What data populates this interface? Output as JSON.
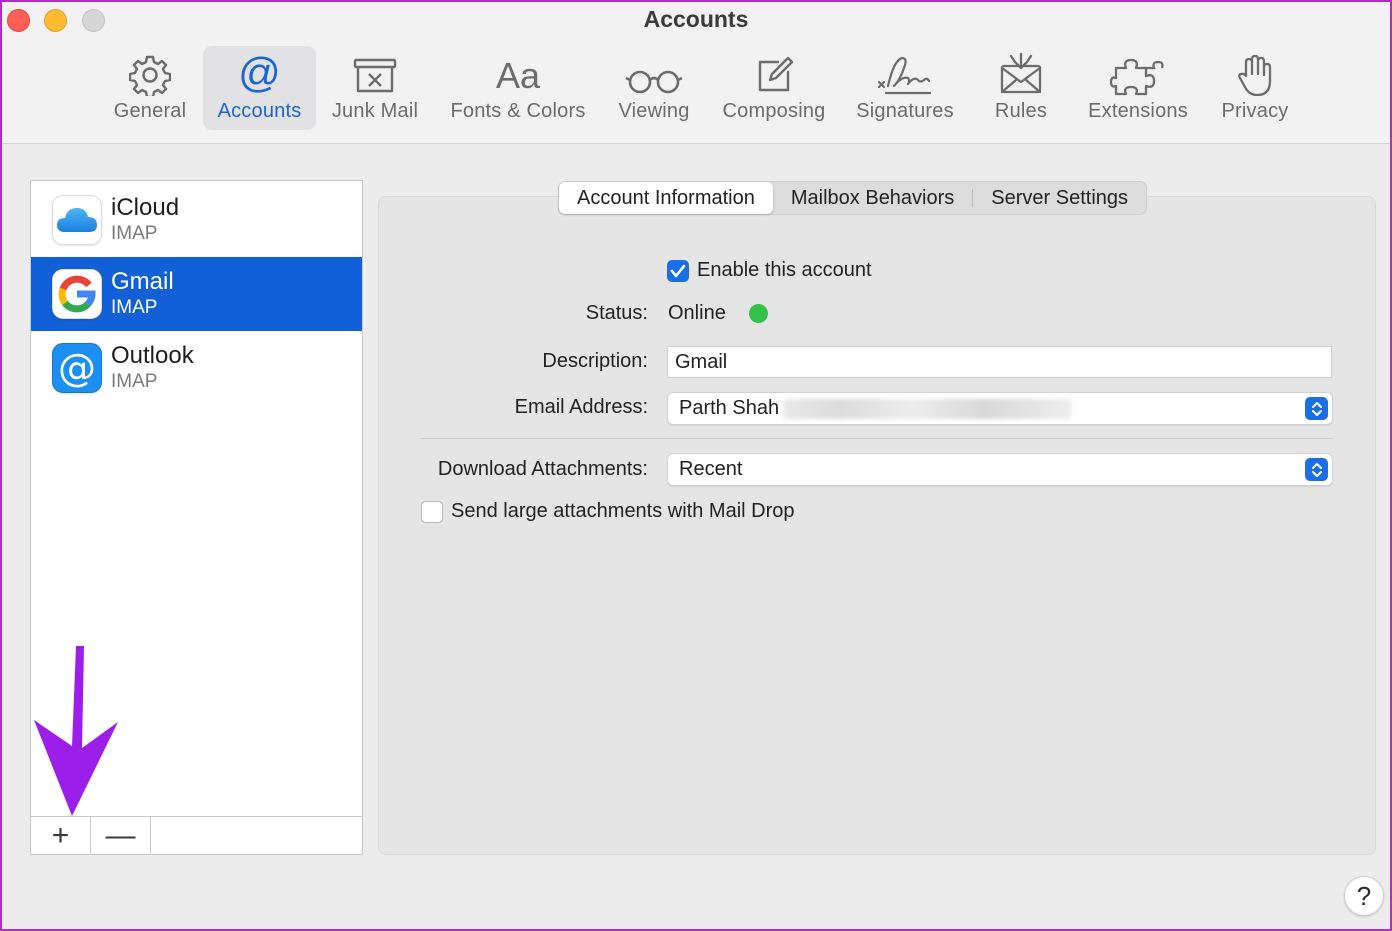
{
  "window": {
    "title": "Accounts"
  },
  "toolbar": {
    "items": [
      {
        "label": "General",
        "icon": "gear-icon"
      },
      {
        "label": "Accounts",
        "icon": "at-icon",
        "glyph": "@"
      },
      {
        "label": "Junk Mail",
        "icon": "junk-icon"
      },
      {
        "label": "Fonts & Colors",
        "icon": "fonts-icon",
        "glyph": "Aa"
      },
      {
        "label": "Viewing",
        "icon": "glasses-icon"
      },
      {
        "label": "Composing",
        "icon": "compose-icon"
      },
      {
        "label": "Signatures",
        "icon": "signature-icon"
      },
      {
        "label": "Rules",
        "icon": "rules-icon"
      },
      {
        "label": "Extensions",
        "icon": "puzzle-icon"
      },
      {
        "label": "Privacy",
        "icon": "hand-icon"
      }
    ],
    "active": "Accounts"
  },
  "sidebar": {
    "accounts": [
      {
        "name": "iCloud",
        "type": "IMAP",
        "icon": "icloud-icon"
      },
      {
        "name": "Gmail",
        "type": "IMAP",
        "icon": "gmail-icon",
        "selected": true
      },
      {
        "name": "Outlook",
        "type": "IMAP",
        "icon": "outlook-icon",
        "glyph": "@"
      }
    ],
    "add_label": "+",
    "remove_label": "—"
  },
  "tabs": [
    {
      "label": "Account Information",
      "active": true
    },
    {
      "label": "Mailbox Behaviors"
    },
    {
      "label": "Server Settings"
    }
  ],
  "form": {
    "enable_label": "Enable this account",
    "enable_checked": true,
    "status_label": "Status:",
    "status_value": "Online",
    "status_color": "#34c14a",
    "description_label": "Description:",
    "description_value": "Gmail",
    "email_label": "Email Address:",
    "email_value": "Parth Shah",
    "download_label": "Download Attachments:",
    "download_value": "Recent",
    "maildrop_label": "Send large attachments with Mail Drop",
    "maildrop_checked": false
  },
  "help": {
    "label": "?"
  },
  "colors": {
    "accent": "#1a6ee8",
    "selection": "#1260d8",
    "annotation_arrow": "#9b1fe8",
    "window_border": "#b02fc2"
  }
}
